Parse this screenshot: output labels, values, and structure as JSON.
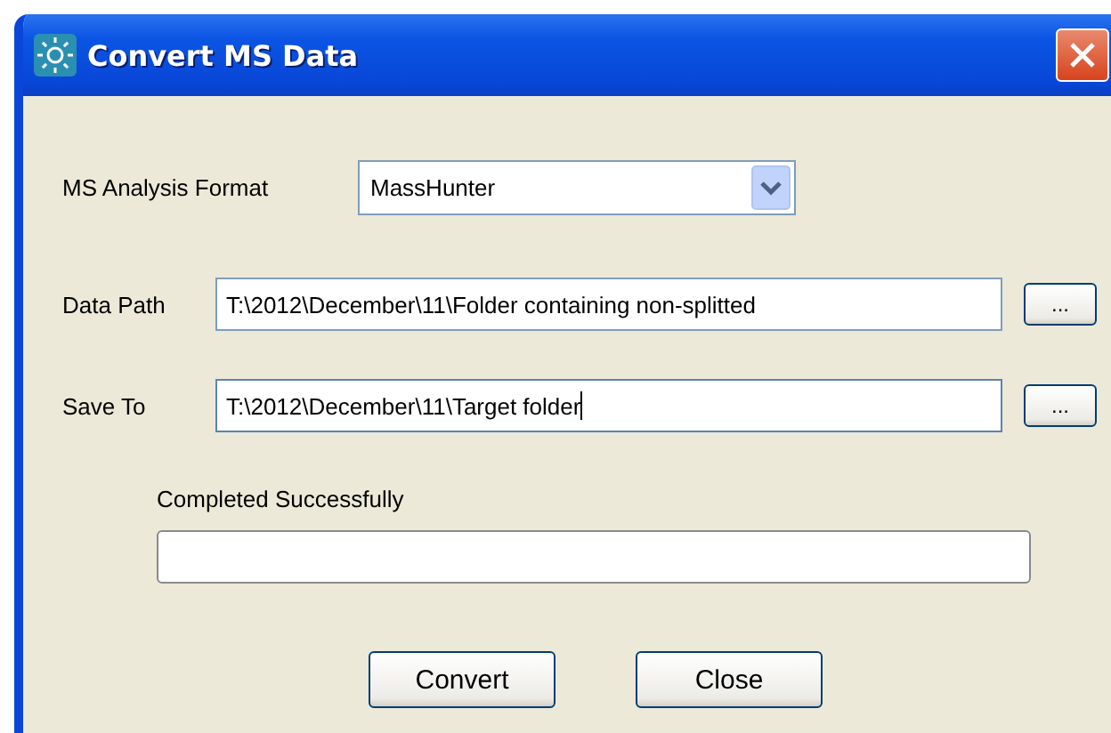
{
  "window": {
    "title": "Convert MS Data"
  },
  "format": {
    "label": "MS Analysis Format",
    "value": "MassHunter"
  },
  "paths": [
    {
      "label": "Data Path",
      "value": "T:\\2012\\December\\11\\Folder containing non-splitted",
      "browse": "...",
      "focused": false
    },
    {
      "label": "Save To",
      "value": "T:\\2012\\December\\11\\Target folder",
      "browse": "...",
      "focused": true
    }
  ],
  "progress": {
    "label": "Completed Successfully"
  },
  "buttons": [
    "Convert",
    "Close"
  ]
}
